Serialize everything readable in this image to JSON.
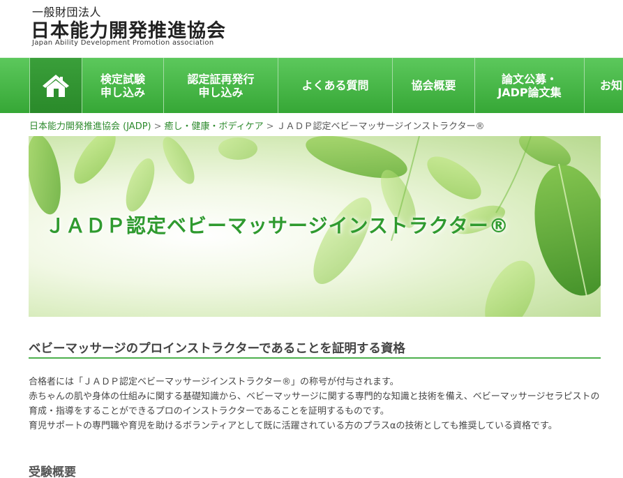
{
  "header": {
    "org_top": "一般財団法人",
    "org_main": "日本能力開発推進協会",
    "org_en": "Japan Ability Development Promotion association"
  },
  "nav": {
    "home_icon": "house-icon",
    "items": [
      {
        "line1": "検定試験",
        "line2": "申し込み"
      },
      {
        "line1": "認定証再発行",
        "line2": "申し込み"
      },
      {
        "line1": "よくある質問",
        "line2": ""
      },
      {
        "line1": "協会概要",
        "line2": ""
      },
      {
        "line1": "論文公募・",
        "line2": "JADP論文集"
      },
      {
        "line1": "お知",
        "line2": ""
      }
    ]
  },
  "breadcrumb": {
    "items": [
      "日本能力開発推進協会 (JADP)",
      "癒し・健康・ボディケア",
      "ＪＡＤＰ認定ベビーマッサージインストラクター®"
    ],
    "separator": ">"
  },
  "banner": {
    "title": "ＪＡＤＰ認定ベビーマッサージインストラクター®"
  },
  "content": {
    "section_title": "ベビーマッサージのプロインストラクターであることを証明する資格",
    "paragraphs": [
      "合格者には「ＪＡＤＰ認定ベビーマッサージインストラクター®」の称号が付与されます。",
      "赤ちゃんの肌や身体の仕組みに関する基礎知識から、ベビーマッサージに関する専門的な知識と技術を備え、ベビーマッサージセラピストの育成・指導をすることができるプロのインストラクターであることを証明するものです。",
      "育児サポートの専門職や育児を助けるボランティアとして既に活躍されている方のプラスαの技術としても推奨している資格です。"
    ],
    "subheading": "受験概要"
  },
  "colors": {
    "nav_green": "#36a736",
    "link_green": "#2d8a2d",
    "banner_title": "#2f9a2f",
    "rule_green": "#4cb04c"
  }
}
